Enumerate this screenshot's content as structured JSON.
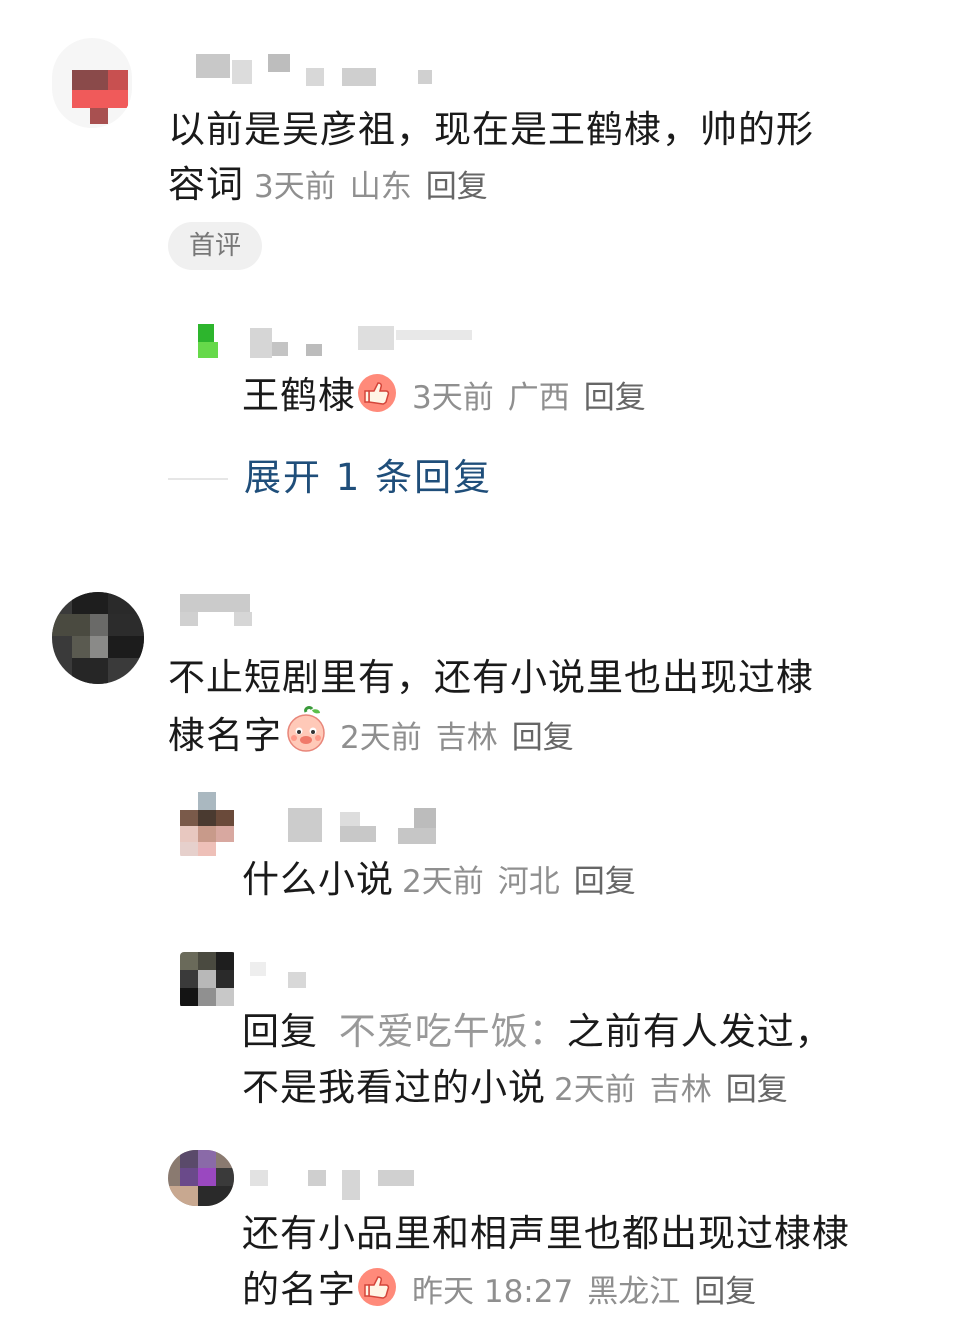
{
  "comments": [
    {
      "text_line1": "以前是吴彦祖，现在是王鹤棣，帅的形",
      "text_line2": "容词",
      "time": "3天前",
      "location": "山东",
      "reply_label": "回复",
      "badge": "首评",
      "replies": [
        {
          "text": "王鹤棣",
          "emoji": "thumbs-up",
          "time": "3天前",
          "location": "广西",
          "reply_label": "回复"
        }
      ],
      "expand_label": "展开 1 条回复"
    },
    {
      "text_line1": "不止短剧里有，还有小说里也出现过棣",
      "text_line2": "棣名字",
      "emoji": "peach-face",
      "time": "2天前",
      "location": "吉林",
      "reply_label": "回复",
      "replies": [
        {
          "text": "什么小说",
          "time": "2天前",
          "location": "河北",
          "reply_label": "回复"
        },
        {
          "prefix": "回复",
          "quote": "不爱吃午饭：",
          "text_line1": "之前有人发过，",
          "text_line2": "不是我看过的小说",
          "time": "2天前",
          "location": "吉林",
          "reply_label": "回复"
        },
        {
          "text_line1": "还有小品里和相声里也都出现过棣棣",
          "text_line2": "的名字",
          "emoji": "thumbs-up",
          "time": "昨天 18:27",
          "location": "黑龙江",
          "reply_label": "回复"
        }
      ]
    }
  ],
  "colors": {
    "link_blue": "#1f4e7a",
    "meta_gray": "#8f8f8f",
    "badge_bg": "#f0f0f0"
  }
}
